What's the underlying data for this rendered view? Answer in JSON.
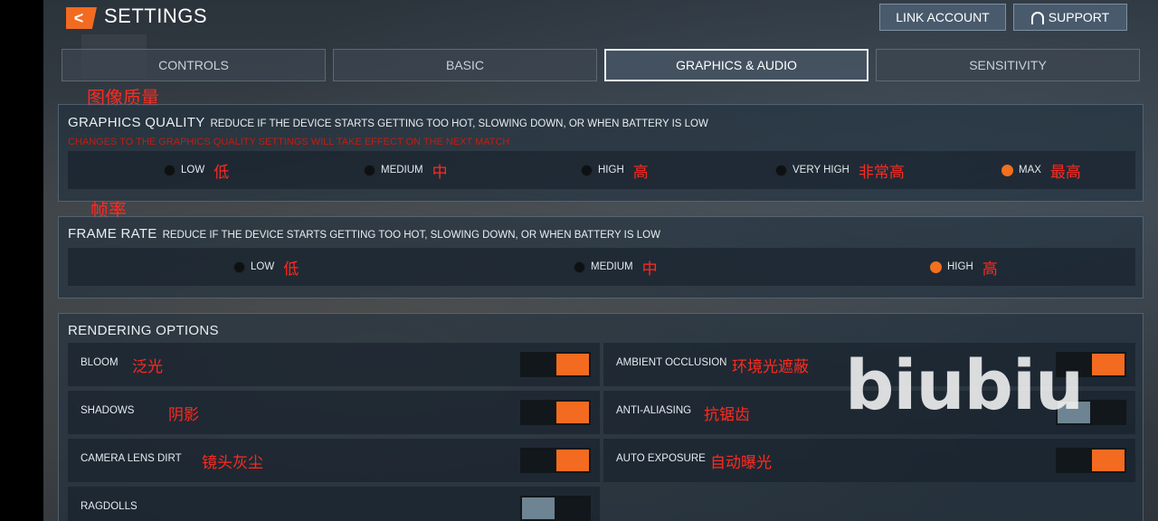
{
  "header": {
    "back_icon": "chevron-left-icon",
    "title": "SETTINGS",
    "link_account": "LINK ACCOUNT",
    "support": "SUPPORT",
    "support_icon": "headset-icon"
  },
  "tabs": [
    {
      "label": "CONTROLS",
      "active": false
    },
    {
      "label": "BASIC",
      "active": false
    },
    {
      "label": "GRAPHICS & AUDIO",
      "active": true
    },
    {
      "label": "SENSITIVITY",
      "active": false
    }
  ],
  "graphics_quality": {
    "cn_heading": "图像质量",
    "title": "GRAPHICS QUALITY",
    "desc": "REDUCE IF THE DEVICE STARTS GETTING TOO HOT, SLOWING DOWN, OR WHEN BATTERY IS LOW",
    "warning": "CHANGES TO THE GRAPHICS QUALITY SETTINGS WILL TAKE EFFECT ON THE NEXT MATCH",
    "options": [
      {
        "label": "LOW",
        "cn": "低",
        "selected": false
      },
      {
        "label": "MEDIUM",
        "cn": "中",
        "selected": false
      },
      {
        "label": "HIGH",
        "cn": "高",
        "selected": false
      },
      {
        "label": "VERY HIGH",
        "cn": "非常高",
        "selected": false
      },
      {
        "label": "MAX",
        "cn": "最高",
        "selected": true
      }
    ]
  },
  "frame_rate": {
    "cn_heading": "帧率",
    "title": "FRAME RATE",
    "desc": "REDUCE IF THE DEVICE STARTS GETTING TOO HOT, SLOWING DOWN, OR WHEN BATTERY IS LOW",
    "options": [
      {
        "label": "LOW",
        "cn": "低",
        "selected": false
      },
      {
        "label": "MEDIUM",
        "cn": "中",
        "selected": false
      },
      {
        "label": "HIGH",
        "cn": "高",
        "selected": true
      }
    ]
  },
  "rendering": {
    "title": "RENDERING OPTIONS",
    "items": [
      {
        "label": "BLOOM",
        "cn": "泛光",
        "on": true
      },
      {
        "label": "AMBIENT OCCLUSION",
        "cn": "环境光遮蔽",
        "on": true
      },
      {
        "label": "SHADOWS",
        "cn": "阴影",
        "on": true
      },
      {
        "label": "ANTI-ALIASING",
        "cn": "抗锯齿",
        "on": false
      },
      {
        "label": "CAMERA LENS DIRT",
        "cn": "镜头灰尘",
        "on": true
      },
      {
        "label": "AUTO EXPOSURE",
        "cn": "自动曝光",
        "on": true
      },
      {
        "label": "RAGDOLLS",
        "cn": "",
        "on": false
      }
    ]
  },
  "watermark": "biubiu",
  "colors": {
    "accent": "#f26b21",
    "annotation": "#ff2a1f",
    "toggle_off": "#6e8493"
  }
}
